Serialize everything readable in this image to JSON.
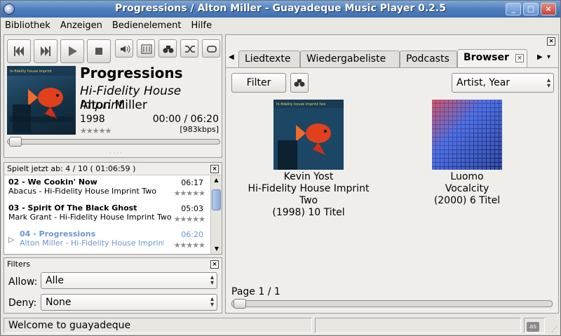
{
  "window": {
    "title": "Progressions / Alton Miller - Guayadeque Music Player 0.2.5"
  },
  "menu": [
    "Bibliothek",
    "Anzeigen",
    "Bedienelement",
    "Hilfe"
  ],
  "now_playing": {
    "title": "Progressions",
    "album": "Hi-Fidelity House Imprint",
    "artist": "Alton Miller",
    "year": "1998",
    "time": "00:00 / 06:20",
    "bitrate": "[983kbps]",
    "stars": "★★★★★",
    "progress": 0
  },
  "playlist": {
    "header": "Spielt jetzt ab:  4 / 10   ( 01:06:59 )",
    "items": [
      {
        "title": "02 - We Cookin' Now",
        "sub": "Abacus - Hi-Fidelity House Imprint Two",
        "duration": "06:17",
        "stars": "★★★★★"
      },
      {
        "title": "03 - Spirit Of The Black Ghost",
        "sub": "Mark Grant - Hi-Fidelity House Imprint Two",
        "duration": "05:03",
        "stars": "★★★★★"
      },
      {
        "title": "04 - Progressions",
        "sub": "Alton Miller - Hi-Fidelity House Imprint",
        "duration": "06:20",
        "stars": "★★★★★"
      }
    ]
  },
  "filters": {
    "title": "Filters",
    "allow_label": "Allow:",
    "allow_value": "Alle",
    "deny_label": "Deny:",
    "deny_value": "None"
  },
  "tabs": [
    "Liedtexte",
    "Wiedergabeliste",
    "Podcasts",
    "Browser"
  ],
  "browser": {
    "filter_label": "Filter",
    "sort_value": "Artist, Year",
    "albums": [
      {
        "artist": "Kevin Yost",
        "album": "Hi-Fidelity House Imprint Two",
        "info": "(1998) 10 Titel"
      },
      {
        "artist": "Luomo",
        "album": "Vocalcity",
        "info": "(2000) 6 Titel"
      }
    ],
    "page": "Page 1 / 1"
  },
  "status": {
    "text": "Welcome to guayadeque",
    "lastfm": "as"
  },
  "colors": {
    "titlebar": "#4f7fbf",
    "played_track": "#6d95cf"
  }
}
